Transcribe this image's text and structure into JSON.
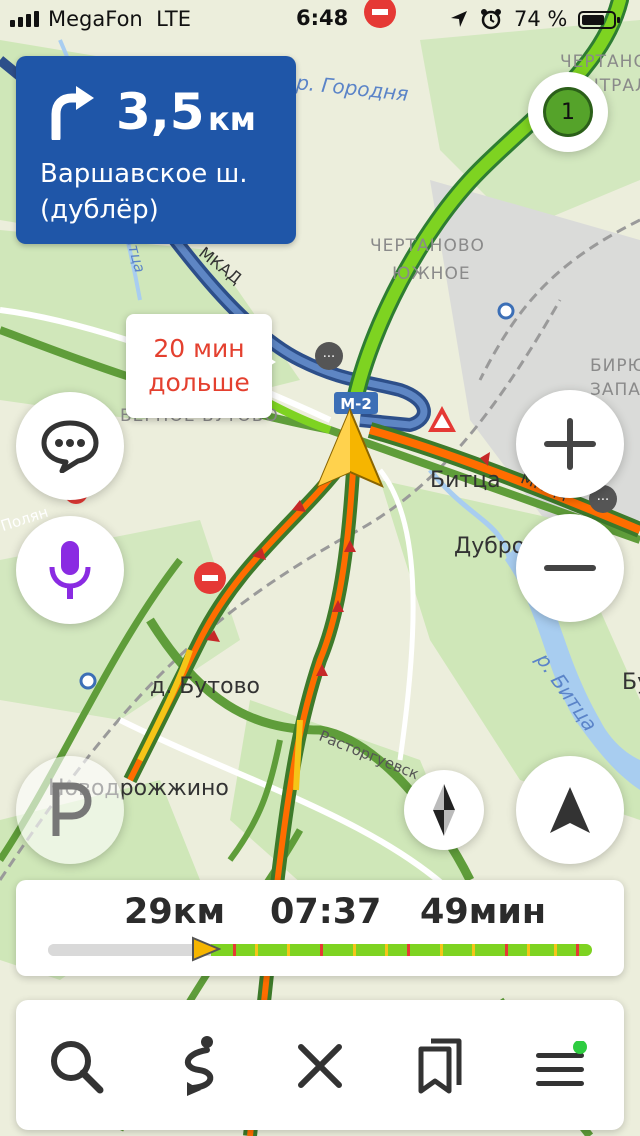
{
  "status_bar": {
    "carrier": "MegaFon",
    "network": "LTE",
    "time": "6:48",
    "battery_percent": "74 %",
    "battery_level": 0.74
  },
  "maneuver": {
    "distance": "3,5",
    "unit": "км",
    "street": "Варшавское ш. (дублёр)",
    "turn_icon": "turn-right-arrow-icon"
  },
  "alt_route_bubble": {
    "line1": "20 мин",
    "line2": "дольше"
  },
  "map": {
    "labels": {
      "river_gorodnya": "р. Городня",
      "district_chertanovo": "ЧЕРТАНОВО",
      "district_yuzhnoe": "ЮЖНОЕ",
      "district_chertanovo_top": "ЧЕРТАНО",
      "district_chertanovo_top2": "ЦЕНТРАЛ",
      "district_biryulevo": "БИРЮЛ",
      "district_biryulevo2": "ЗАПАД",
      "district_butovo": "ВЕРНОЕ БУТОВО",
      "river_bitsa_small": "Битца",
      "mkad": "МКАД",
      "mkad_east": "МКАД",
      "road_m2": "М-2",
      "bitsa": "Битца",
      "dubrovsky": "Дубровский",
      "river_bitsa": "р. Битца",
      "d_butovo": "д. Бутово",
      "novodrozhzhino": "Новодрожжино",
      "rastorguevskoe": "Расторгуевск",
      "bu": "Бу",
      "polyan": "Полян"
    },
    "speed_badge": "1"
  },
  "trip": {
    "distance": "29км",
    "arrival": "07:37",
    "duration": "49мин",
    "progress": 0.3,
    "colors": {
      "traffic_green": "#7ed321",
      "traffic_yellow": "#f5c518",
      "traffic_red": "#e53935",
      "brand_blue": "#1f56a8"
    }
  },
  "toolbar": {
    "search": "search-icon",
    "route": "route-icon",
    "close": "close-icon",
    "bookmarks": "bookmarks-icon",
    "menu": "menu-icon"
  }
}
